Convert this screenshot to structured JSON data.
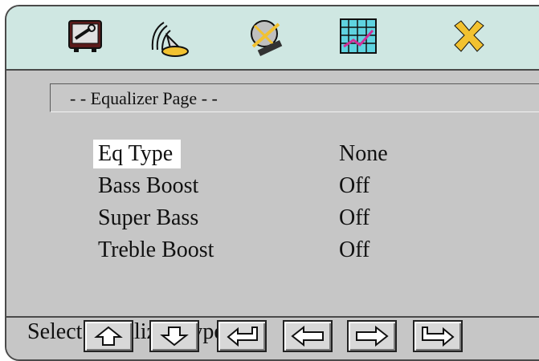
{
  "toolbar": {
    "icons": [
      {
        "name": "system-setup-icon"
      },
      {
        "name": "audio-setup-icon"
      },
      {
        "name": "video-setup-icon"
      },
      {
        "name": "equalizer-icon",
        "selected": true
      },
      {
        "name": "exit-icon"
      }
    ]
  },
  "page": {
    "title": "- - Equalizer  Page - -"
  },
  "menu": {
    "items": [
      {
        "label": "Eq Type",
        "value": "None",
        "selected": true
      },
      {
        "label": "Bass Boost",
        "value": "Off"
      },
      {
        "label": "Super Bass",
        "value": "Off"
      },
      {
        "label": "Treble Boost",
        "value": "Off"
      }
    ]
  },
  "footer": {
    "help_text": "Select Equalizer Type",
    "nav_buttons": [
      "up-arrow-icon",
      "down-arrow-icon",
      "enter-icon",
      "left-arrow-icon",
      "right-arrow-icon",
      "return-icon"
    ]
  },
  "colors": {
    "icon_bar": "#cfe7e2",
    "panel": "#c6c6c6",
    "selected_item": "#ffffff"
  }
}
